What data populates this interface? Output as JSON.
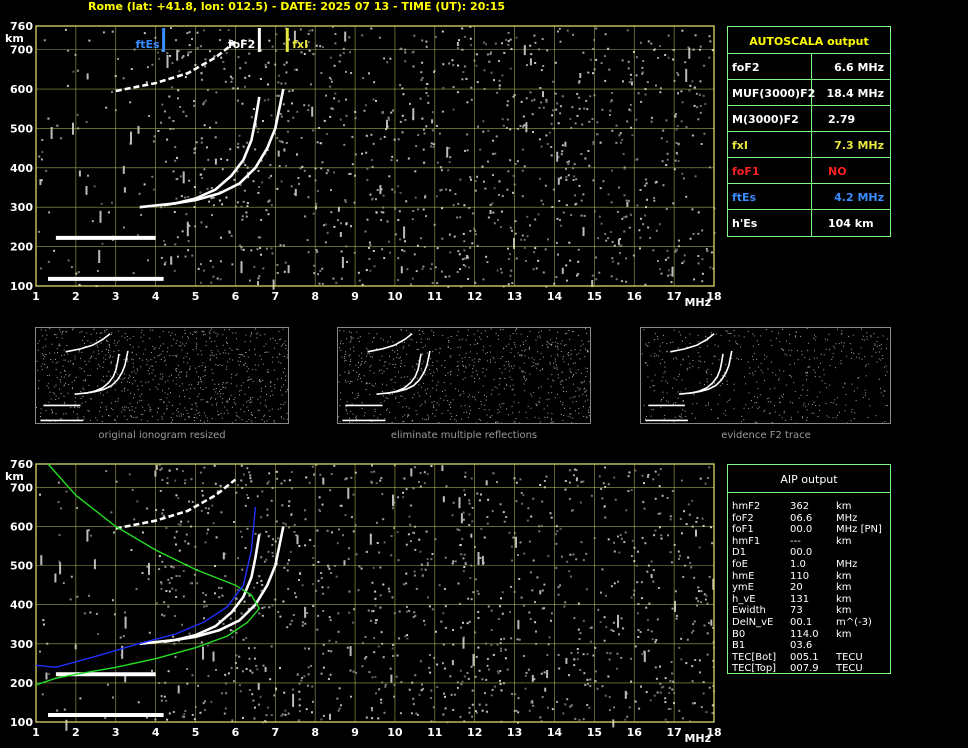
{
  "header": {
    "title": "Rome (lat: +41.8, lon: 012.5) - DATE: 2025 07 13 - TIME (UT): 20:15"
  },
  "autoscala": {
    "title": "AUTOSCALA output",
    "rows": [
      {
        "label": "foF2",
        "value": "6.6 MHz",
        "color": "#ffffff"
      },
      {
        "label": "MUF(3000)F2",
        "value": "18.4 MHz",
        "color": "#ffffff"
      },
      {
        "label": "M(3000)F2",
        "value": "2.79",
        "color": "#ffffff"
      },
      {
        "label": "fxI",
        "value": "7.3 MHz",
        "color": "#e6e640"
      },
      {
        "label": "foF1",
        "value": "NO",
        "color": "#ff2020"
      },
      {
        "label": "ftEs",
        "value": "4.2 MHz",
        "color": "#3a8cff"
      },
      {
        "label": "h'Es",
        "value": "104    km",
        "color": "#ffffff"
      }
    ]
  },
  "aip": {
    "title": "AIP output",
    "rows": [
      {
        "k": "hmF2",
        "v": "362",
        "u": "km"
      },
      {
        "k": "foF2",
        "v": "06.6",
        "u": "MHz"
      },
      {
        "k": "foF1",
        "v": "00.0",
        "u": "MHz   [PN]"
      },
      {
        "k": "hmF1",
        "v": "---",
        "u": "km"
      },
      {
        "k": "D1",
        "v": "00.0",
        "u": ""
      },
      {
        "k": "foE",
        "v": "1.0",
        "u": "MHz"
      },
      {
        "k": "hmE",
        "v": "110",
        "u": "km"
      },
      {
        "k": "ymE",
        "v": "20",
        "u": "km"
      },
      {
        "k": "h_vE",
        "v": "131",
        "u": "km"
      },
      {
        "k": "Ewidth",
        "v": "73",
        "u": "km"
      },
      {
        "k": "DelN_vE",
        "v": "00.1",
        "u": "m^(-3)"
      },
      {
        "k": "B0",
        "v": "114.0",
        "u": "km"
      },
      {
        "k": "B1",
        "v": "03.6",
        "u": ""
      },
      {
        "k": "TEC[Bot]",
        "v": "005.1",
        "u": "TECU"
      },
      {
        "k": "TEC[Top]",
        "v": "007.9",
        "u": "TECU"
      }
    ]
  },
  "thumbnails": {
    "captions": [
      "original ionogram resized",
      "eliminate multiple reflections",
      "evidence F2 trace"
    ]
  },
  "chart_data": [
    {
      "type": "scatter",
      "title": "",
      "xunit": "MHz",
      "yunit": "km",
      "xlim": [
        1,
        18
      ],
      "ylim": [
        100,
        760
      ],
      "xticks": [
        "1",
        "2",
        "3",
        "4",
        "5",
        "6",
        "7",
        "8",
        "9",
        "10",
        "11",
        "12",
        "13",
        "14",
        "15",
        "16",
        "17",
        "18"
      ],
      "yticks": [
        "100",
        "200",
        "300",
        "400",
        "500",
        "600",
        "700",
        "760"
      ],
      "grid": true,
      "markers": [
        {
          "label": "ftEs",
          "x": 4.2,
          "color": "#3a8cff"
        },
        {
          "label": "foF2",
          "x": 6.6,
          "color": "#ffffff"
        },
        {
          "label": "fxI",
          "x": 7.3,
          "color": "#e6e640"
        }
      ],
      "traces": [
        {
          "name": "Es",
          "x": [
            1.3,
            4.2
          ],
          "y": [
            118,
            118
          ]
        },
        {
          "name": "Es-2",
          "x": [
            1.5,
            4.0
          ],
          "y": [
            222,
            222
          ]
        },
        {
          "name": "F2-o",
          "x": [
            3.6,
            4.5,
            5.0,
            5.5,
            5.9,
            6.2,
            6.4,
            6.5,
            6.6
          ],
          "y": [
            300,
            310,
            322,
            345,
            380,
            420,
            470,
            520,
            580
          ]
        },
        {
          "name": "F2-x",
          "x": [
            4.2,
            5.0,
            5.6,
            6.1,
            6.5,
            6.8,
            7.0,
            7.1,
            7.2
          ],
          "y": [
            305,
            318,
            335,
            360,
            400,
            450,
            500,
            550,
            600
          ]
        },
        {
          "name": "F2-2hop",
          "x": [
            3.0,
            4.0,
            4.8,
            5.5,
            6.0
          ],
          "y": [
            595,
            615,
            640,
            680,
            720
          ]
        }
      ]
    },
    {
      "type": "line",
      "title": "",
      "xunit": "MHz",
      "yunit": "km",
      "xlim": [
        1,
        18
      ],
      "ylim": [
        100,
        760
      ],
      "xticks": [
        "1",
        "2",
        "3",
        "4",
        "5",
        "6",
        "7",
        "8",
        "9",
        "10",
        "11",
        "12",
        "13",
        "14",
        "15",
        "16",
        "17",
        "18"
      ],
      "yticks": [
        "100",
        "200",
        "300",
        "400",
        "500",
        "600",
        "700",
        "760"
      ],
      "grid": true,
      "series": [
        {
          "color": "#22dd22",
          "x": [
            1.0,
            1.5,
            2.0,
            3.0,
            4.0,
            5.0,
            5.8,
            6.3,
            6.6,
            6.4,
            6.0,
            5.0,
            4.0,
            3.0,
            2.0,
            1.3
          ],
          "y": [
            195,
            212,
            222,
            240,
            262,
            290,
            320,
            355,
            390,
            425,
            450,
            490,
            540,
            600,
            680,
            760
          ]
        },
        {
          "color": "#2030ff",
          "x": [
            1.0,
            1.5,
            2.5,
            3.5,
            4.5,
            5.2,
            5.8,
            6.2,
            6.4,
            6.5
          ],
          "y": [
            245,
            240,
            268,
            298,
            325,
            355,
            395,
            450,
            540,
            650
          ]
        }
      ],
      "traces": [
        {
          "name": "Es",
          "x": [
            1.3,
            4.2
          ],
          "y": [
            118,
            118
          ]
        },
        {
          "name": "Es-2",
          "x": [
            1.5,
            4.0
          ],
          "y": [
            222,
            222
          ]
        },
        {
          "name": "F2-o",
          "x": [
            3.6,
            4.5,
            5.0,
            5.5,
            5.9,
            6.2,
            6.4,
            6.5,
            6.6
          ],
          "y": [
            300,
            310,
            322,
            345,
            380,
            420,
            470,
            520,
            580
          ]
        },
        {
          "name": "F2-x",
          "x": [
            4.2,
            5.0,
            5.6,
            6.1,
            6.5,
            6.8,
            7.0,
            7.1,
            7.2
          ],
          "y": [
            305,
            318,
            335,
            360,
            400,
            450,
            500,
            550,
            600
          ]
        },
        {
          "name": "F2-2hop",
          "x": [
            3.0,
            4.0,
            4.8,
            5.5,
            6.0
          ],
          "y": [
            595,
            615,
            640,
            680,
            720
          ]
        }
      ]
    }
  ]
}
